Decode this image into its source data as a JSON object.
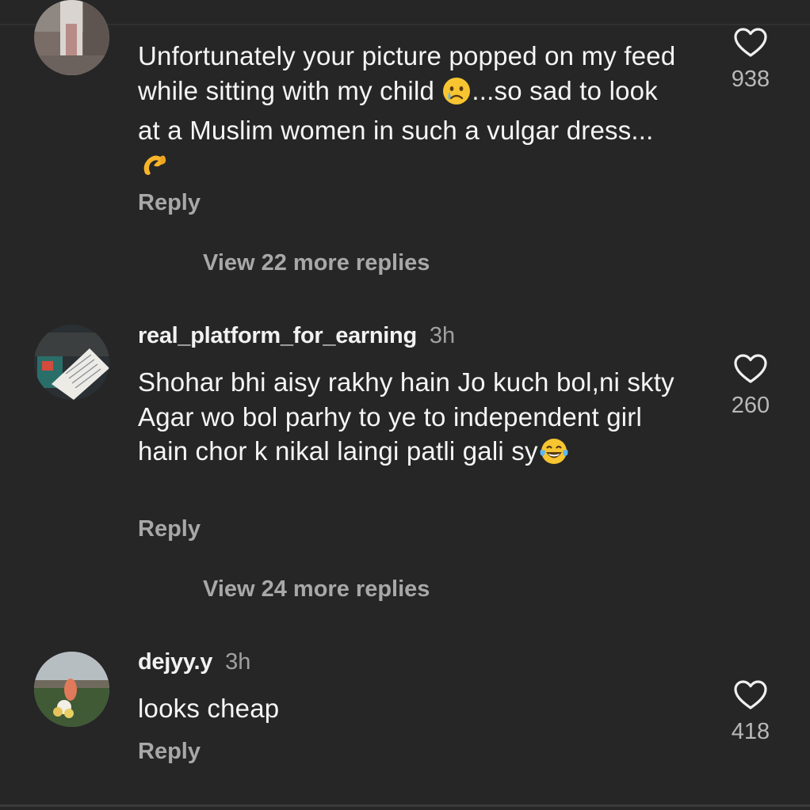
{
  "comments": [
    {
      "text_before": "Unfortunately your picture popped on my feed  while sitting with my child ",
      "emoji_1": "crying-face",
      "text_middle": "...so sad to look at a Muslim women in such a vulgar dress...",
      "emoji_2": "pinching-hand",
      "reply_label": "Reply",
      "likes": "938",
      "view_more": "View 22 more replies"
    },
    {
      "username": "real_platform_for_earning",
      "time": "3h",
      "text_before": "Shohar bhi aisy rakhy hain Jo kuch bol,ni skty Agar wo bol parhy to ye to independent girl hain chor k nikal laingi patli gali sy",
      "emoji_1": "face-with-tears-of-joy",
      "reply_label": "Reply",
      "likes": "260",
      "view_more": "View 24 more replies"
    },
    {
      "username": "dejyy.y",
      "time": "3h",
      "text_before": "looks cheap",
      "reply_label": "Reply",
      "likes": "418"
    }
  ],
  "colors": {
    "background": "#262626",
    "primary_text": "#f5f5f5",
    "secondary_text": "#a8a8a8",
    "heart_stroke": "#f0f0f0"
  },
  "icons": {
    "like": "heart-outline-icon"
  }
}
